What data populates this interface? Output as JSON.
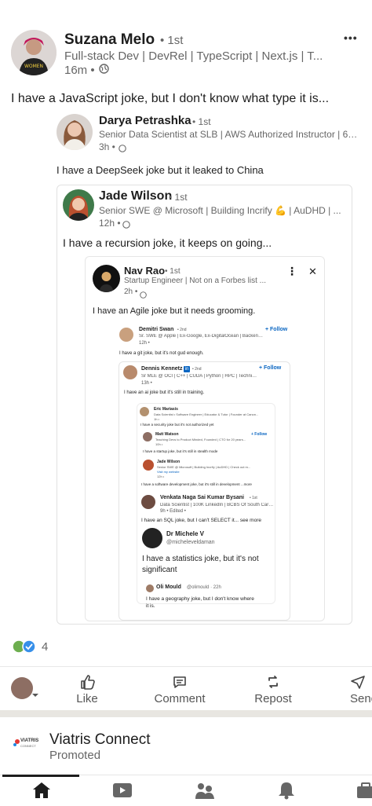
{
  "post": {
    "author": "Suzana Melo",
    "degree": "• 1st",
    "headline": "Full-stack Dev | DevRel | TypeScript | Next.js | T...",
    "time": "16m •",
    "text": "I have a JavaScript joke, but I don't know what type it is...",
    "more_label": "•••"
  },
  "quote1": {
    "author": "Darya Petrashka",
    "degree": "• 1st",
    "headline": "Senior Data Scientist at SLB | AWS Authorized Instructor | 6 ...",
    "time": "3h •",
    "text": "I have a DeepSeek joke but it leaked to China"
  },
  "quote2": {
    "author": "Jade Wilson",
    "degree": "• 1st",
    "headline": "Senior SWE @ Microsoft | Building Incrify 💪 | AuDHD | ...",
    "time": "12h •",
    "text": "I have a recursion joke, it keeps on going..."
  },
  "quote3": {
    "author": "Nav Rao",
    "degree": "• 1st",
    "headline": "Startup Engineer | Not on a Forbes list ...",
    "time": "2h •",
    "text": "I have an Agile joke but it needs grooming.",
    "menu": "⋮",
    "close": "✕"
  },
  "nested": {
    "demitri": {
      "name": "Demitri Swan",
      "degree": "• 2nd",
      "headline": "Sr. SWE @ Apple | Ex-Google, Ex-DigitalOcean | Backend, In...",
      "time": "12h •",
      "text": "I have a git joke, but it's not gud enough.",
      "follow": "+ Follow"
    },
    "dennis": {
      "name": "Dennis Kennetz",
      "degree": "• 2nd",
      "headline": "Sr MLE @ OCI | C++ | CUDA | Python | HPC | Technical ...",
      "time": "13h •",
      "text": "I have an ai joke but it's still in training.",
      "follow": "+ Follow"
    },
    "eric": {
      "name": "Eric Mariasis",
      "degree": "• 1st",
      "headline": "Data Scientist • Software Engineer | Educator & Tutor | Founder at Canon...",
      "time": "1h •",
      "text": "I have a security joke but it's not authorized yet"
    },
    "matt": {
      "name": "Matt Watson",
      "degree": "• 2nd",
      "headline": "Teaching Devs to Product Minded, Founded | CTO for 20 years...",
      "time": "10h •",
      "text": "I have a startup joke, but it's still in stealth mode",
      "follow": "+ Follow"
    },
    "jade2": {
      "name": "Jade Wilson",
      "degree": "• 1st",
      "headline": "Senior SWE @ Microsoft | Building Incrify | AuDHD | Check out m...",
      "link": "Visit my website",
      "time": "12h •",
      "text": "I have a software development joke, but it's still in development ...more"
    },
    "venkata": {
      "name": "Venkata Naga Sai Kumar Bysani",
      "degree": "• 1st",
      "headline": "Data Scientist | 100K LinkedIn | BCBS Of South Carolin...",
      "time": "9h • Edited •",
      "text": "I have an SQL joke, but I can't SELECT it... see more"
    },
    "michele": {
      "name": "Dr Michele V",
      "handle": "@micheleveldaman",
      "text": "I have a statistics joke, but it's not significant"
    },
    "oli": {
      "name": "Oli Mould",
      "handle": "@olimould · 22h",
      "text": "I have a geography joke, but I don't know where it is."
    }
  },
  "reactions": {
    "count": "4"
  },
  "actions": {
    "like": "Like",
    "comment": "Comment",
    "repost": "Repost",
    "send": "Send"
  },
  "promo": {
    "brand": "Viatris Connect",
    "label": "Promoted",
    "logo_text": "VIATRIS",
    "logo_sub": "CONNECT"
  },
  "colors": {
    "accent": "#0a66c2",
    "text": "#1d1d1d",
    "muted": "#666666",
    "divider": "#e8e6e1"
  }
}
